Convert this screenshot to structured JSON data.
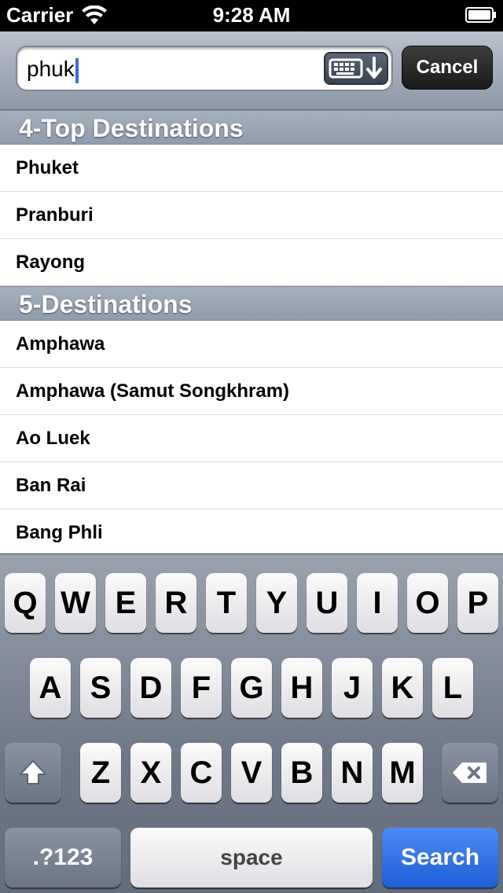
{
  "status_bar": {
    "carrier": "Carrier",
    "time": "9:28 AM",
    "icons": [
      "wifi-icon",
      "battery-icon"
    ]
  },
  "search": {
    "value": "phuk",
    "cancel_label": "Cancel",
    "dismiss_icon": "keyboard-dismiss-icon"
  },
  "sections": [
    {
      "title": "4-Top Destinations",
      "items": [
        "Phuket",
        "Pranburi",
        "Rayong"
      ]
    },
    {
      "title": "5-Destinations",
      "items": [
        "Amphawa",
        "Amphawa (Samut Songkhram)",
        "Ao Luek",
        "Ban Rai",
        "Bang Phli"
      ]
    }
  ],
  "keyboard": {
    "row1": [
      "Q",
      "W",
      "E",
      "R",
      "T",
      "Y",
      "U",
      "I",
      "O",
      "P"
    ],
    "row2": [
      "A",
      "S",
      "D",
      "F",
      "G",
      "H",
      "J",
      "K",
      "L"
    ],
    "row3": [
      "Z",
      "X",
      "C",
      "V",
      "B",
      "N",
      "M"
    ],
    "shift_icon": "shift-icon",
    "delete_icon": "backspace-icon",
    "numbers_label": ".?123",
    "space_label": "space",
    "search_label": "Search"
  },
  "colors": {
    "accent_blue": "#1f5fd7",
    "caret": "#3b6bd6"
  }
}
